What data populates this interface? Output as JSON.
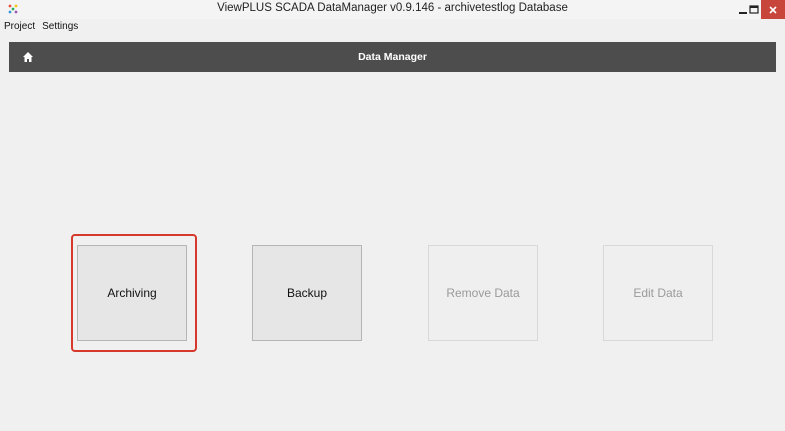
{
  "window": {
    "title": "ViewPLUS SCADA DataManager v0.9.146 - archivetestlog Database",
    "controls": {
      "minimize_icon": "minimize-icon",
      "maximize_icon": "maximize-icon",
      "close_icon": "close-icon",
      "close_color": "#c7453a"
    }
  },
  "menu": {
    "items": [
      "Project",
      "Settings"
    ]
  },
  "header": {
    "title": "Data Manager",
    "home_icon": "home-icon",
    "background": "#4d4d4d"
  },
  "tiles": [
    {
      "label": "Archiving",
      "enabled": true,
      "highlighted": true
    },
    {
      "label": "Backup",
      "enabled": true,
      "highlighted": false
    },
    {
      "label": "Remove Data",
      "enabled": false,
      "highlighted": false
    },
    {
      "label": "Edit Data",
      "enabled": false,
      "highlighted": false
    }
  ],
  "colors": {
    "highlight": "#d6392c"
  }
}
